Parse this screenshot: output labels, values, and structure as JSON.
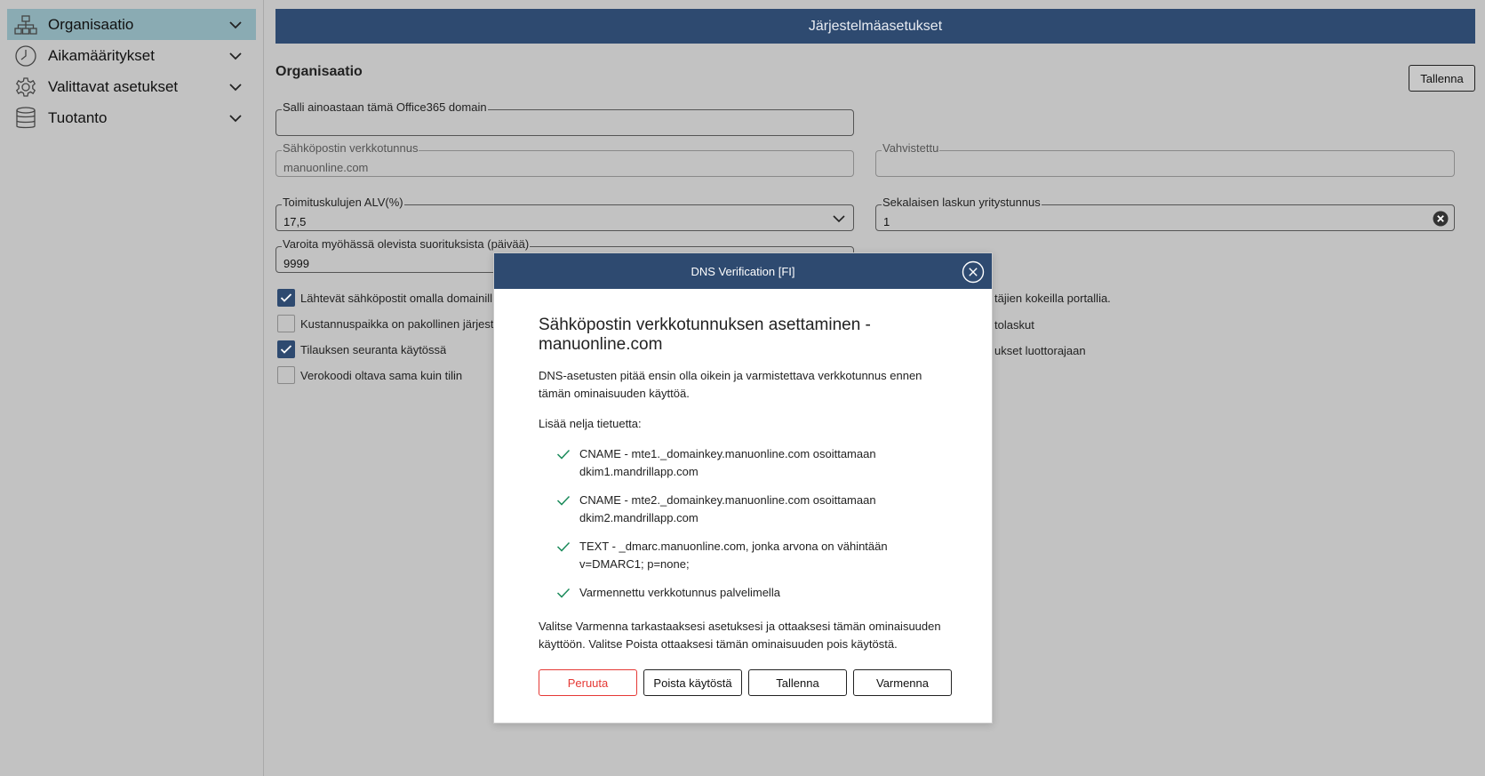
{
  "sidebar": {
    "items": [
      {
        "label": "Organisaatio",
        "icon": "org-chart-icon",
        "active": true
      },
      {
        "label": "Aikamääritykset",
        "icon": "clock-icon",
        "active": false
      },
      {
        "label": "Valittavat asetukset",
        "icon": "gear-icon",
        "active": false
      },
      {
        "label": "Tuotanto",
        "icon": "database-icon",
        "active": false
      }
    ]
  },
  "header": {
    "title": "Järjestelmäasetukset"
  },
  "section": {
    "title": "Organisaatio",
    "save_label": "Tallenna"
  },
  "fields": {
    "office365": {
      "label": "Salli ainoastaan tämä Office365 domain",
      "value": ""
    },
    "email_domain": {
      "label": "Sähköpostin verkkotunnus",
      "value": "manuonline.com"
    },
    "verified": {
      "label": "Vahvistettu",
      "value": ""
    },
    "vat": {
      "label": "Toimituskulujen ALV(%)",
      "value": "17,5"
    },
    "misc_company": {
      "label": "Sekalaisen laskun yritystunnus",
      "value": "1"
    },
    "late_warning": {
      "label": "Varoita myöhässä olevista suorituksista (päivää)",
      "value": "9999"
    }
  },
  "checkboxes": [
    {
      "label": "Lähtevät sähköpostit omalla domainill",
      "checked": true
    },
    {
      "label": "Kustannuspaikka on pakollinen järjest",
      "checked": false
    },
    {
      "label": "Tilauksen seuranta käytössä",
      "checked": true
    },
    {
      "label": "Verokoodi oltava sama kuin tilin",
      "checked": false
    }
  ],
  "partial_texts": [
    "täjien kokeilla portallia.",
    "tolaskut",
    "ukset luottorajaan"
  ],
  "modal": {
    "header": "DNS Verification [FI]",
    "title": "Sähköpostin verkkotunnuksen asettaminen - manuonline.com",
    "intro": "DNS-asetusten pitää ensin olla oikein ja varmistettava verkkotunnus ennen tämän ominaisuuden käyttöä.",
    "add_records": "Lisää nelja tietuetta:",
    "records": [
      "CNAME - mte1._domainkey.manuonline.com osoittamaan dkim1.mandrillapp.com",
      "CNAME - mte2._domainkey.manuonline.com osoittamaan dkim2.mandrillapp.com",
      "TEXT - _dmarc.manuonline.com, jonka arvona on vähintään v=DMARC1; p=none;",
      "Varmennettu verkkotunnus palvelimella"
    ],
    "footer": "Valitse Varmenna tarkastaaksesi asetuksesi ja ottaaksesi tämän ominaisuuden käyttöön. Valitse Poista ottaaksesi tämän ominaisuuden pois käytöstä.",
    "buttons": {
      "cancel": "Peruuta",
      "disable": "Poista käytöstä",
      "save": "Tallenna",
      "verify": "Varmenna"
    }
  },
  "colors": {
    "header_bg": "#2e4a70",
    "active_nav": "#8aabb3",
    "check_green": "#1a8a5a",
    "danger": "#e53935",
    "overlay_bg": "#c2c2c2"
  }
}
